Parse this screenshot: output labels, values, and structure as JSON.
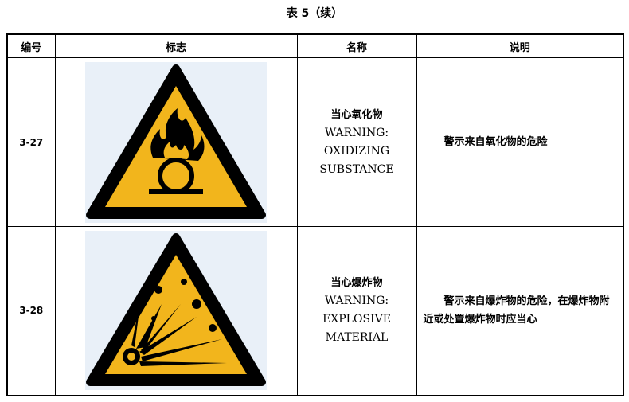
{
  "caption": "表 5（续）",
  "headers": {
    "code": "编号",
    "sign": "标志",
    "name": "名称",
    "desc": "说明"
  },
  "rows": [
    {
      "code": "3-27",
      "sign_icon": "oxidizing-substance-warning-icon",
      "name_zh": "当心氧化物",
      "name_en": [
        "WARNING:",
        "OXIDIZING",
        "SUBSTANCE"
      ],
      "desc": "警示来自氧化物的危险"
    },
    {
      "code": "3-28",
      "sign_icon": "explosive-material-warning-icon",
      "name_zh": "当心爆炸物",
      "name_en": [
        "WARNING:",
        "EXPLOSIVE",
        "MATERIAL"
      ],
      "desc": "警示来自爆炸物的危险，在爆炸物附近或处置爆炸物时应当心"
    }
  ],
  "colors": {
    "sign_yellow": "#F2B51C",
    "sign_border": "#000000",
    "sign_bg": "#E9F0F8"
  }
}
